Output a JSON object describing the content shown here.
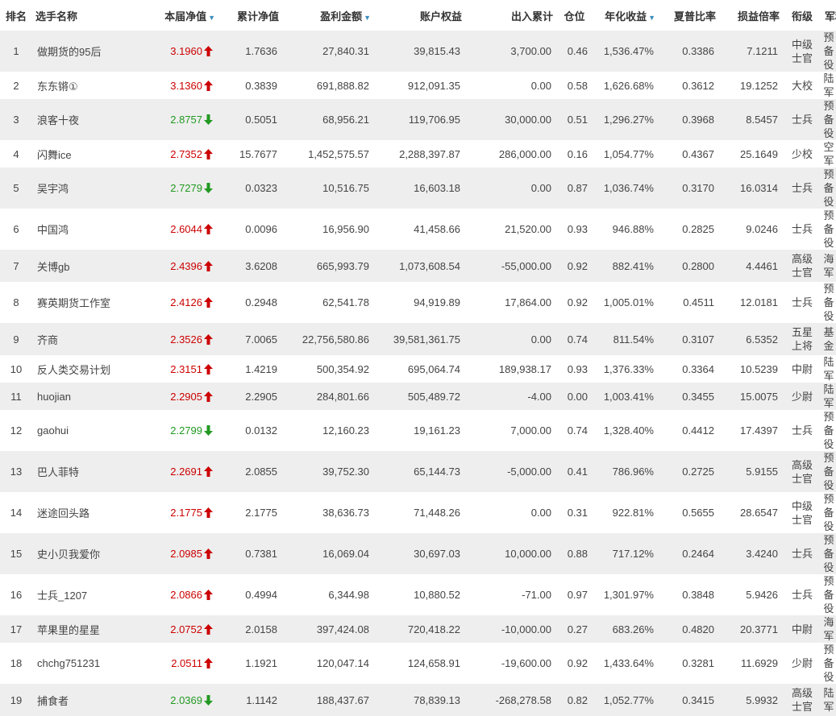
{
  "columns": [
    {
      "label": "排名",
      "sort": false
    },
    {
      "label": "选手名称",
      "sort": false
    },
    {
      "label": "本届净值",
      "sort": true
    },
    {
      "label": "累计净值",
      "sort": false
    },
    {
      "label": "盈利金额",
      "sort": true
    },
    {
      "label": "账户权益",
      "sort": false
    },
    {
      "label": "出入累计",
      "sort": false
    },
    {
      "label": "仓位",
      "sort": false
    },
    {
      "label": "年化收益",
      "sort": true
    },
    {
      "label": "夏普比率",
      "sort": false
    },
    {
      "label": "损益倍率",
      "sort": false
    },
    {
      "label": "衔级",
      "sort": false
    },
    {
      "label": "军种",
      "sort": false
    }
  ],
  "colors": {
    "up": "#cc0000",
    "down": "#229922",
    "sort_icon": "#3c8dbc",
    "row_alt": "#eeeeee"
  },
  "rows": [
    {
      "rank": "1",
      "name": "做期货的95后",
      "nav": "3.1960",
      "trend": "up",
      "cum_nav": "1.7636",
      "profit": "27,840.31",
      "equity": "39,815.43",
      "flow": "3,700.00",
      "position": "0.46",
      "annual": "1,536.47%",
      "sharpe": "0.3386",
      "pl_ratio": "7.1211",
      "rank_title": "中级士官",
      "branch": "预备役"
    },
    {
      "rank": "2",
      "name": "东东锵①",
      "nav": "3.1360",
      "trend": "up",
      "cum_nav": "0.3839",
      "profit": "691,888.82",
      "equity": "912,091.35",
      "flow": "0.00",
      "position": "0.58",
      "annual": "1,626.68%",
      "sharpe": "0.3612",
      "pl_ratio": "19.1252",
      "rank_title": "大校",
      "branch": "陆军"
    },
    {
      "rank": "3",
      "name": "浪客十夜",
      "nav": "2.8757",
      "trend": "down",
      "cum_nav": "0.5051",
      "profit": "68,956.21",
      "equity": "119,706.95",
      "flow": "30,000.00",
      "position": "0.51",
      "annual": "1,296.27%",
      "sharpe": "0.3968",
      "pl_ratio": "8.5457",
      "rank_title": "士兵",
      "branch": "预备役"
    },
    {
      "rank": "4",
      "name": "闪舞ice",
      "nav": "2.7352",
      "trend": "up",
      "cum_nav": "15.7677",
      "profit": "1,452,575.57",
      "equity": "2,288,397.87",
      "flow": "286,000.00",
      "position": "0.16",
      "annual": "1,054.77%",
      "sharpe": "0.4367",
      "pl_ratio": "25.1649",
      "rank_title": "少校",
      "branch": "空军"
    },
    {
      "rank": "5",
      "name": "吴宇鸿",
      "nav": "2.7279",
      "trend": "down",
      "cum_nav": "0.0323",
      "profit": "10,516.75",
      "equity": "16,603.18",
      "flow": "0.00",
      "position": "0.87",
      "annual": "1,036.74%",
      "sharpe": "0.3170",
      "pl_ratio": "16.0314",
      "rank_title": "士兵",
      "branch": "预备役"
    },
    {
      "rank": "6",
      "name": "中国鸿",
      "nav": "2.6044",
      "trend": "up",
      "cum_nav": "0.0096",
      "profit": "16,956.90",
      "equity": "41,458.66",
      "flow": "21,520.00",
      "position": "0.93",
      "annual": "946.88%",
      "sharpe": "0.2825",
      "pl_ratio": "9.0246",
      "rank_title": "士兵",
      "branch": "预备役"
    },
    {
      "rank": "7",
      "name": "关博gb",
      "nav": "2.4396",
      "trend": "up",
      "cum_nav": "3.6208",
      "profit": "665,993.79",
      "equity": "1,073,608.54",
      "flow": "-55,000.00",
      "position": "0.92",
      "annual": "882.41%",
      "sharpe": "0.2800",
      "pl_ratio": "4.4461",
      "rank_title": "高级士官",
      "branch": "海军"
    },
    {
      "rank": "8",
      "name": "赛英期货工作室",
      "nav": "2.4126",
      "trend": "up",
      "cum_nav": "0.2948",
      "profit": "62,541.78",
      "equity": "94,919.89",
      "flow": "17,864.00",
      "position": "0.92",
      "annual": "1,005.01%",
      "sharpe": "0.4511",
      "pl_ratio": "12.0181",
      "rank_title": "士兵",
      "branch": "预备役"
    },
    {
      "rank": "9",
      "name": "齐商",
      "nav": "2.3526",
      "trend": "up",
      "cum_nav": "7.0065",
      "profit": "22,756,580.86",
      "equity": "39,581,361.75",
      "flow": "0.00",
      "position": "0.74",
      "annual": "811.54%",
      "sharpe": "0.3107",
      "pl_ratio": "6.5352",
      "rank_title": "五星上将",
      "branch": "基金"
    },
    {
      "rank": "10",
      "name": "反人类交易计划",
      "nav": "2.3151",
      "trend": "up",
      "cum_nav": "1.4219",
      "profit": "500,354.92",
      "equity": "695,064.74",
      "flow": "189,938.17",
      "position": "0.93",
      "annual": "1,376.33%",
      "sharpe": "0.3364",
      "pl_ratio": "10.5239",
      "rank_title": "中尉",
      "branch": "陆军"
    },
    {
      "rank": "11",
      "name": "huojian",
      "nav": "2.2905",
      "trend": "up",
      "cum_nav": "2.2905",
      "profit": "284,801.66",
      "equity": "505,489.72",
      "flow": "-4.00",
      "position": "0.00",
      "annual": "1,003.41%",
      "sharpe": "0.3455",
      "pl_ratio": "15.0075",
      "rank_title": "少尉",
      "branch": "陆军"
    },
    {
      "rank": "12",
      "name": "gaohui",
      "nav": "2.2799",
      "trend": "down",
      "cum_nav": "0.0132",
      "profit": "12,160.23",
      "equity": "19,161.23",
      "flow": "7,000.00",
      "position": "0.74",
      "annual": "1,328.40%",
      "sharpe": "0.4412",
      "pl_ratio": "17.4397",
      "rank_title": "士兵",
      "branch": "预备役"
    },
    {
      "rank": "13",
      "name": "巴人菲特",
      "nav": "2.2691",
      "trend": "up",
      "cum_nav": "2.0855",
      "profit": "39,752.30",
      "equity": "65,144.73",
      "flow": "-5,000.00",
      "position": "0.41",
      "annual": "786.96%",
      "sharpe": "0.2725",
      "pl_ratio": "5.9155",
      "rank_title": "高级士官",
      "branch": "预备役"
    },
    {
      "rank": "14",
      "name": "迷途回头路",
      "nav": "2.1775",
      "trend": "up",
      "cum_nav": "2.1775",
      "profit": "38,636.73",
      "equity": "71,448.26",
      "flow": "0.00",
      "position": "0.31",
      "annual": "922.81%",
      "sharpe": "0.5655",
      "pl_ratio": "28.6547",
      "rank_title": "中级士官",
      "branch": "预备役"
    },
    {
      "rank": "15",
      "name": "史小贝我爱你",
      "nav": "2.0985",
      "trend": "up",
      "cum_nav": "0.7381",
      "profit": "16,069.04",
      "equity": "30,697.03",
      "flow": "10,000.00",
      "position": "0.88",
      "annual": "717.12%",
      "sharpe": "0.2464",
      "pl_ratio": "3.4240",
      "rank_title": "士兵",
      "branch": "预备役"
    },
    {
      "rank": "16",
      "name": "士兵_1207",
      "nav": "2.0866",
      "trend": "up",
      "cum_nav": "0.4994",
      "profit": "6,344.98",
      "equity": "10,880.52",
      "flow": "-71.00",
      "position": "0.97",
      "annual": "1,301.97%",
      "sharpe": "0.3848",
      "pl_ratio": "5.9426",
      "rank_title": "士兵",
      "branch": "预备役"
    },
    {
      "rank": "17",
      "name": "苹果里的星星",
      "nav": "2.0752",
      "trend": "up",
      "cum_nav": "2.0158",
      "profit": "397,424.08",
      "equity": "720,418.22",
      "flow": "-10,000.00",
      "position": "0.27",
      "annual": "683.26%",
      "sharpe": "0.4820",
      "pl_ratio": "20.3771",
      "rank_title": "中尉",
      "branch": "海军"
    },
    {
      "rank": "18",
      "name": "chchg751231",
      "nav": "2.0511",
      "trend": "up",
      "cum_nav": "1.1921",
      "profit": "120,047.14",
      "equity": "124,658.91",
      "flow": "-19,600.00",
      "position": "0.92",
      "annual": "1,433.64%",
      "sharpe": "0.3281",
      "pl_ratio": "11.6929",
      "rank_title": "少尉",
      "branch": "预备役"
    },
    {
      "rank": "19",
      "name": "捕食者",
      "nav": "2.0369",
      "trend": "down",
      "cum_nav": "1.1142",
      "profit": "188,437.67",
      "equity": "78,839.13",
      "flow": "-268,278.58",
      "position": "0.82",
      "annual": "1,052.77%",
      "sharpe": "0.3415",
      "pl_ratio": "5.9932",
      "rank_title": "高级士官",
      "branch": "陆军"
    }
  ]
}
